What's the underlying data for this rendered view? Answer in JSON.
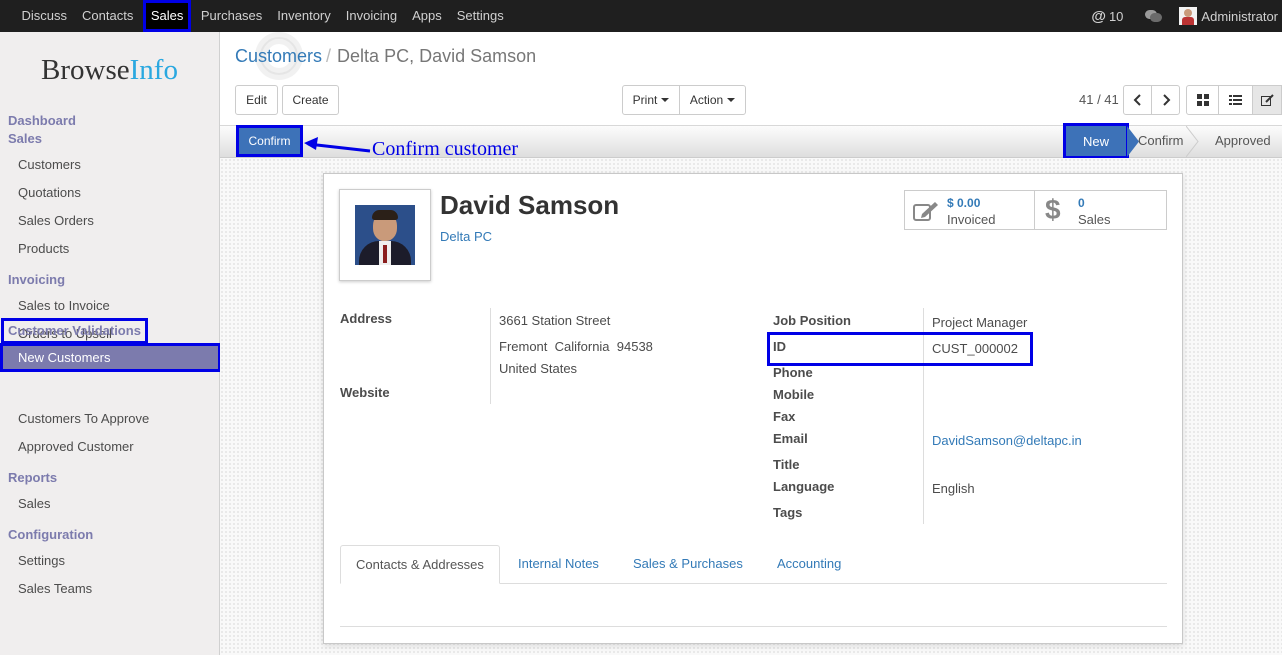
{
  "topbar": {
    "menu": [
      "Discuss",
      "Contacts",
      "Sales",
      "Purchases",
      "Inventory",
      "Invoicing",
      "Apps",
      "Settings"
    ],
    "mention_count": "10",
    "user": "Administrator"
  },
  "sidebar": {
    "logo_main": "Browse",
    "logo_accent": "Info",
    "dashboard": "Dashboard",
    "sales_head": "Sales",
    "sales_items": [
      "Customers",
      "Quotations",
      "Sales Orders",
      "Products"
    ],
    "invoicing_head": "Invoicing",
    "invoicing_items": [
      "Sales to Invoice",
      "Orders to Upsell"
    ],
    "validations_head": "Customer Validations",
    "validations_items": [
      "New Customers",
      "Customers To Approve",
      "Approved Customer"
    ],
    "reports_head": "Reports",
    "reports_items": [
      "Sales"
    ],
    "config_head": "Configuration",
    "config_items": [
      "Settings",
      "Sales Teams"
    ]
  },
  "breadcrumb": {
    "parent": "Customers",
    "sep": "/",
    "current": "Delta PC, David Samson"
  },
  "toolbar": {
    "edit": "Edit",
    "create": "Create",
    "print": "Print",
    "action": "Action",
    "pager": "41 / 41"
  },
  "statusbar": {
    "confirm_button": "Confirm",
    "annotation": "Confirm customer",
    "stages": [
      "New",
      "Confirm",
      "Approved"
    ],
    "active_stage": "New"
  },
  "record": {
    "name": "David Samson",
    "company": "Delta PC",
    "invoiced_value": "$ 0.00",
    "invoiced_label": "Invoiced",
    "sales_value": "0",
    "sales_label": "Sales"
  },
  "fields": {
    "address_label": "Address",
    "street": "3661 Station Street",
    "city_line": "Fremont  California  94538",
    "country": "United States",
    "website_label": "Website",
    "job_position_label": "Job Position",
    "job_position": "Project Manager",
    "id_label": "ID",
    "id": "CUST_000002",
    "phone_label": "Phone",
    "mobile_label": "Mobile",
    "fax_label": "Fax",
    "email_label": "Email",
    "email": "DavidSamson@deltapc.in",
    "title_label": "Title",
    "language_label": "Language",
    "language": "English",
    "tags_label": "Tags"
  },
  "tabs": [
    "Contacts & Addresses",
    "Internal Notes",
    "Sales & Purchases",
    "Accounting"
  ],
  "colors": {
    "highlight": "#0000e6",
    "primary": "#3d72b8",
    "sidebar_head": "#7c7bad",
    "link": "#337ab7"
  }
}
